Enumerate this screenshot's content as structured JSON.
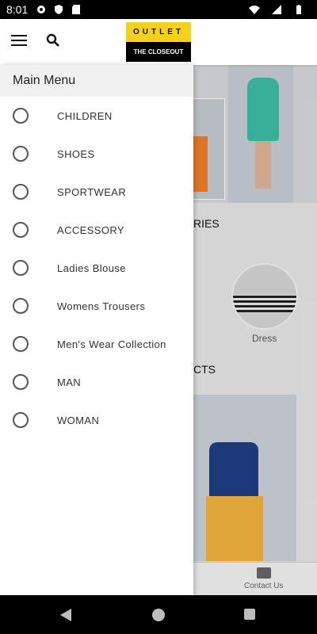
{
  "status_bar": {
    "time": "8:01",
    "icons": [
      "gear-icon",
      "shield-icon",
      "sd-card-icon",
      "wifi-icon",
      "signal-icon",
      "battery-icon"
    ]
  },
  "header": {
    "logo_top": "OUTLET",
    "logo_bottom": "THE CLOSEOUT",
    "colors": {
      "logo_yellow": "#f7d117",
      "logo_black": "#000000"
    }
  },
  "drawer": {
    "title": "Main Menu",
    "items": [
      {
        "label": "CHILDREN"
      },
      {
        "label": "SHOES"
      },
      {
        "label": "SPORTWEAR"
      },
      {
        "label": "ACCESSORY"
      },
      {
        "label": "Ladies Blouse"
      },
      {
        "label": "Womens Trousers"
      },
      {
        "label": "Men's Wear Collection"
      },
      {
        "label": "MAN"
      },
      {
        "label": "WOMAN"
      }
    ]
  },
  "background": {
    "categories_title_partial": "RIES",
    "category_item_label": "Dress",
    "products_title_partial": "CTS",
    "bottom_nav": {
      "contact_label": "Contact Us"
    }
  }
}
